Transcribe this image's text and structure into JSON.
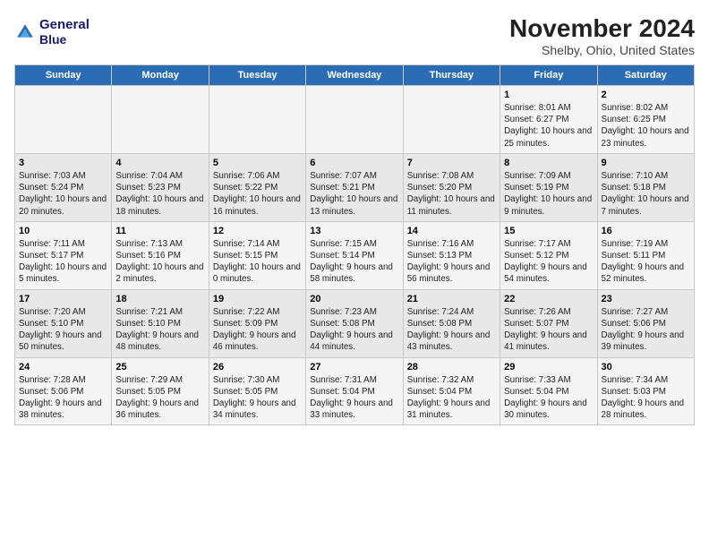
{
  "header": {
    "logo_line1": "General",
    "logo_line2": "Blue",
    "title": "November 2024",
    "subtitle": "Shelby, Ohio, United States"
  },
  "weekdays": [
    "Sunday",
    "Monday",
    "Tuesday",
    "Wednesday",
    "Thursday",
    "Friday",
    "Saturday"
  ],
  "weeks": [
    [
      {
        "day": "",
        "info": ""
      },
      {
        "day": "",
        "info": ""
      },
      {
        "day": "",
        "info": ""
      },
      {
        "day": "",
        "info": ""
      },
      {
        "day": "",
        "info": ""
      },
      {
        "day": "1",
        "info": "Sunrise: 8:01 AM\nSunset: 6:27 PM\nDaylight: 10 hours and 25 minutes."
      },
      {
        "day": "2",
        "info": "Sunrise: 8:02 AM\nSunset: 6:25 PM\nDaylight: 10 hours and 23 minutes."
      }
    ],
    [
      {
        "day": "3",
        "info": "Sunrise: 7:03 AM\nSunset: 5:24 PM\nDaylight: 10 hours and 20 minutes."
      },
      {
        "day": "4",
        "info": "Sunrise: 7:04 AM\nSunset: 5:23 PM\nDaylight: 10 hours and 18 minutes."
      },
      {
        "day": "5",
        "info": "Sunrise: 7:06 AM\nSunset: 5:22 PM\nDaylight: 10 hours and 16 minutes."
      },
      {
        "day": "6",
        "info": "Sunrise: 7:07 AM\nSunset: 5:21 PM\nDaylight: 10 hours and 13 minutes."
      },
      {
        "day": "7",
        "info": "Sunrise: 7:08 AM\nSunset: 5:20 PM\nDaylight: 10 hours and 11 minutes."
      },
      {
        "day": "8",
        "info": "Sunrise: 7:09 AM\nSunset: 5:19 PM\nDaylight: 10 hours and 9 minutes."
      },
      {
        "day": "9",
        "info": "Sunrise: 7:10 AM\nSunset: 5:18 PM\nDaylight: 10 hours and 7 minutes."
      }
    ],
    [
      {
        "day": "10",
        "info": "Sunrise: 7:11 AM\nSunset: 5:17 PM\nDaylight: 10 hours and 5 minutes."
      },
      {
        "day": "11",
        "info": "Sunrise: 7:13 AM\nSunset: 5:16 PM\nDaylight: 10 hours and 2 minutes."
      },
      {
        "day": "12",
        "info": "Sunrise: 7:14 AM\nSunset: 5:15 PM\nDaylight: 10 hours and 0 minutes."
      },
      {
        "day": "13",
        "info": "Sunrise: 7:15 AM\nSunset: 5:14 PM\nDaylight: 9 hours and 58 minutes."
      },
      {
        "day": "14",
        "info": "Sunrise: 7:16 AM\nSunset: 5:13 PM\nDaylight: 9 hours and 56 minutes."
      },
      {
        "day": "15",
        "info": "Sunrise: 7:17 AM\nSunset: 5:12 PM\nDaylight: 9 hours and 54 minutes."
      },
      {
        "day": "16",
        "info": "Sunrise: 7:19 AM\nSunset: 5:11 PM\nDaylight: 9 hours and 52 minutes."
      }
    ],
    [
      {
        "day": "17",
        "info": "Sunrise: 7:20 AM\nSunset: 5:10 PM\nDaylight: 9 hours and 50 minutes."
      },
      {
        "day": "18",
        "info": "Sunrise: 7:21 AM\nSunset: 5:10 PM\nDaylight: 9 hours and 48 minutes."
      },
      {
        "day": "19",
        "info": "Sunrise: 7:22 AM\nSunset: 5:09 PM\nDaylight: 9 hours and 46 minutes."
      },
      {
        "day": "20",
        "info": "Sunrise: 7:23 AM\nSunset: 5:08 PM\nDaylight: 9 hours and 44 minutes."
      },
      {
        "day": "21",
        "info": "Sunrise: 7:24 AM\nSunset: 5:08 PM\nDaylight: 9 hours and 43 minutes."
      },
      {
        "day": "22",
        "info": "Sunrise: 7:26 AM\nSunset: 5:07 PM\nDaylight: 9 hours and 41 minutes."
      },
      {
        "day": "23",
        "info": "Sunrise: 7:27 AM\nSunset: 5:06 PM\nDaylight: 9 hours and 39 minutes."
      }
    ],
    [
      {
        "day": "24",
        "info": "Sunrise: 7:28 AM\nSunset: 5:06 PM\nDaylight: 9 hours and 38 minutes."
      },
      {
        "day": "25",
        "info": "Sunrise: 7:29 AM\nSunset: 5:05 PM\nDaylight: 9 hours and 36 minutes."
      },
      {
        "day": "26",
        "info": "Sunrise: 7:30 AM\nSunset: 5:05 PM\nDaylight: 9 hours and 34 minutes."
      },
      {
        "day": "27",
        "info": "Sunrise: 7:31 AM\nSunset: 5:04 PM\nDaylight: 9 hours and 33 minutes."
      },
      {
        "day": "28",
        "info": "Sunrise: 7:32 AM\nSunset: 5:04 PM\nDaylight: 9 hours and 31 minutes."
      },
      {
        "day": "29",
        "info": "Sunrise: 7:33 AM\nSunset: 5:04 PM\nDaylight: 9 hours and 30 minutes."
      },
      {
        "day": "30",
        "info": "Sunrise: 7:34 AM\nSunset: 5:03 PM\nDaylight: 9 hours and 28 minutes."
      }
    ]
  ]
}
